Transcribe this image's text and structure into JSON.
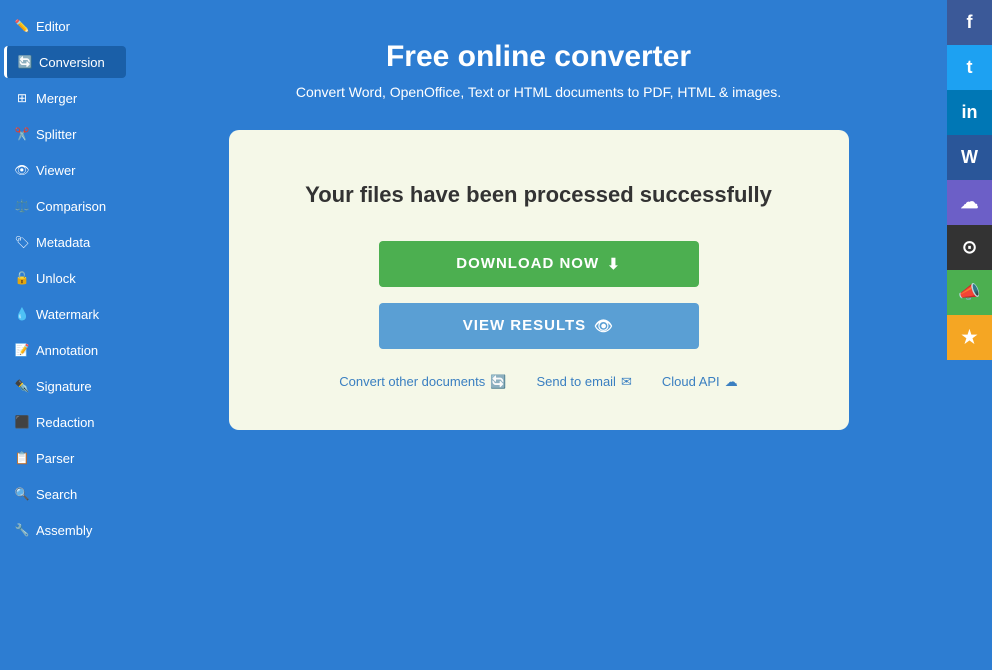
{
  "sidebar": {
    "items": [
      {
        "id": "editor",
        "label": "Editor",
        "icon": "✏️",
        "active": false
      },
      {
        "id": "conversion",
        "label": "Conversion",
        "icon": "🔄",
        "active": true
      },
      {
        "id": "merger",
        "label": "Merger",
        "icon": "⊞",
        "active": false
      },
      {
        "id": "splitter",
        "label": "Splitter",
        "icon": "✂️",
        "active": false
      },
      {
        "id": "viewer",
        "label": "Viewer",
        "icon": "👁",
        "active": false
      },
      {
        "id": "comparison",
        "label": "Comparison",
        "icon": "⚖️",
        "active": false
      },
      {
        "id": "metadata",
        "label": "Metadata",
        "icon": "🏷",
        "active": false
      },
      {
        "id": "unlock",
        "label": "Unlock",
        "icon": "🔓",
        "active": false
      },
      {
        "id": "watermark",
        "label": "Watermark",
        "icon": "💧",
        "active": false
      },
      {
        "id": "annotation",
        "label": "Annotation",
        "icon": "📝",
        "active": false
      },
      {
        "id": "signature",
        "label": "Signature",
        "icon": "✒️",
        "active": false
      },
      {
        "id": "redaction",
        "label": "Redaction",
        "icon": "⬛",
        "active": false
      },
      {
        "id": "parser",
        "label": "Parser",
        "icon": "📋",
        "active": false
      },
      {
        "id": "search",
        "label": "Search",
        "icon": "🔍",
        "active": false
      },
      {
        "id": "assembly",
        "label": "Assembly",
        "icon": "🔧",
        "active": false
      }
    ]
  },
  "header": {
    "title": "Free online converter",
    "subtitle": "Convert Word, OpenOffice, Text or HTML documents to PDF, HTML & images."
  },
  "card": {
    "success_message": "Your files have been processed successfully",
    "download_button": "DOWNLOAD NOW",
    "view_results_button": "VIEW RESULTS",
    "convert_other_link": "Convert other documents",
    "send_email_link": "Send to email",
    "cloud_api_link": "Cloud API"
  },
  "social": [
    {
      "id": "facebook",
      "label": "f",
      "class": "social-facebook"
    },
    {
      "id": "twitter",
      "label": "t",
      "class": "social-twitter"
    },
    {
      "id": "linkedin",
      "label": "in",
      "class": "social-linkedin"
    },
    {
      "id": "word",
      "label": "W",
      "class": "social-word"
    },
    {
      "id": "cloud",
      "label": "☁",
      "class": "social-cloud"
    },
    {
      "id": "github",
      "label": "⊙",
      "class": "social-github"
    },
    {
      "id": "announce",
      "label": "📣",
      "class": "social-announce"
    },
    {
      "id": "star",
      "label": "★",
      "class": "social-star"
    }
  ]
}
